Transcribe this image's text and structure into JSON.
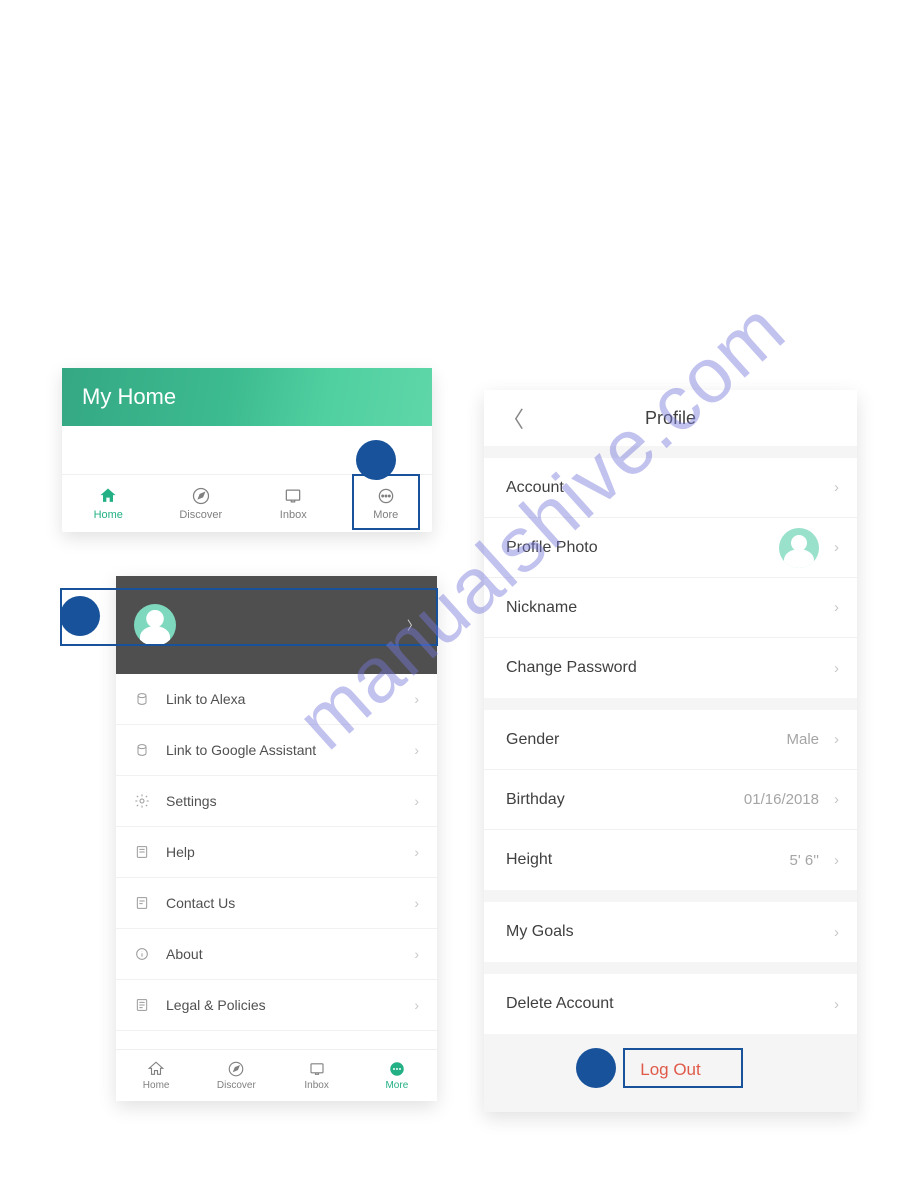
{
  "watermark": "manualshive.com",
  "panel1": {
    "title": "My Home",
    "tabs": [
      "Home",
      "Discover",
      "Inbox",
      "More"
    ]
  },
  "panel2": {
    "items": [
      "Link to Alexa",
      "Link to Google Assistant",
      "Settings",
      "Help",
      "Contact Us",
      "About",
      "Legal & Policies"
    ],
    "tabs": [
      "Home",
      "Discover",
      "Inbox",
      "More"
    ]
  },
  "panel3": {
    "title": "Profile",
    "rows": {
      "account": "Account",
      "photo": "Profile Photo",
      "nickname": "Nickname",
      "changepw": "Change Password",
      "gender": "Gender",
      "gender_val": "Male",
      "birthday": "Birthday",
      "birthday_val": "01/16/2018",
      "height": "Height",
      "height_val": "5' 6''",
      "goals": "My Goals",
      "delete": "Delete Account",
      "logout": "Log Out"
    }
  }
}
